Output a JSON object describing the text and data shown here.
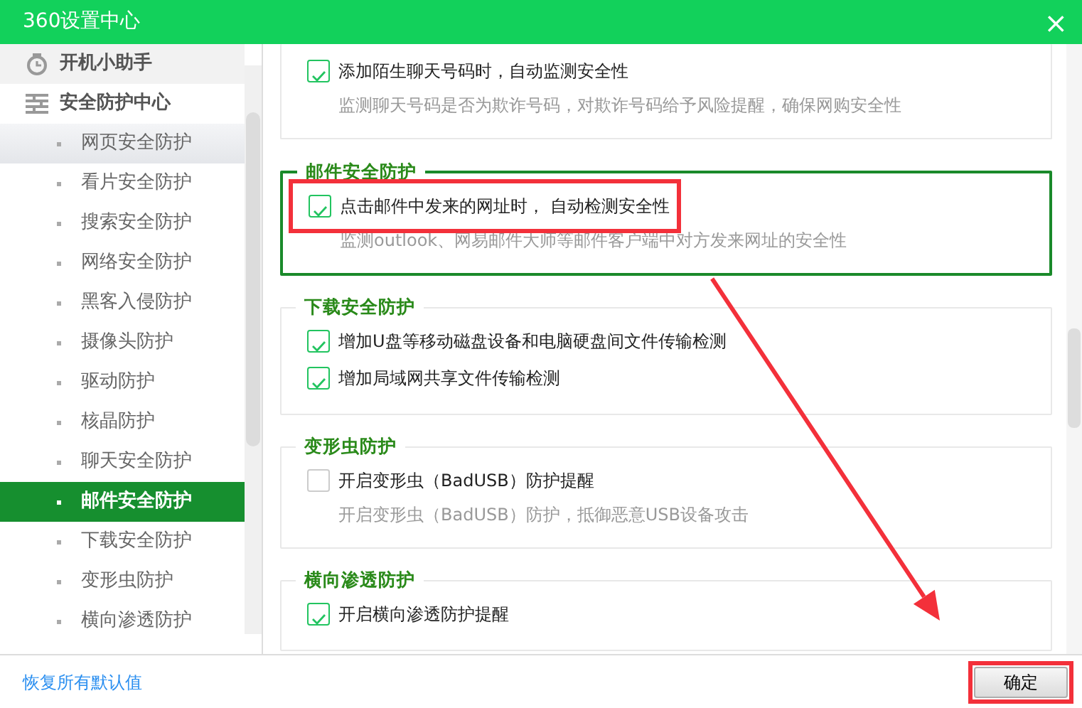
{
  "window": {
    "title": "360设置中心",
    "close": "×"
  },
  "sidebar": {
    "groups": [
      {
        "label": "开机小助手",
        "kind": "clock"
      },
      {
        "label": "安全防护中心",
        "kind": "wall",
        "children": [
          {
            "label": "网页安全防护",
            "selected": false,
            "hovered": true
          },
          {
            "label": "看片安全防护",
            "selected": false,
            "hovered": false
          },
          {
            "label": "搜索安全防护",
            "selected": false,
            "hovered": false
          },
          {
            "label": "网络安全防护",
            "selected": false,
            "hovered": false
          },
          {
            "label": "黑客入侵防护",
            "selected": false,
            "hovered": false
          },
          {
            "label": "摄像头防护",
            "selected": false,
            "hovered": false
          },
          {
            "label": "驱动防护",
            "selected": false,
            "hovered": false
          },
          {
            "label": "核晶防护",
            "selected": false,
            "hovered": false
          },
          {
            "label": "聊天安全防护",
            "selected": false,
            "hovered": false
          },
          {
            "label": "邮件安全防护",
            "selected": true,
            "hovered": false
          },
          {
            "label": "下载安全防护",
            "selected": false,
            "hovered": false
          },
          {
            "label": "变形虫防护",
            "selected": false,
            "hovered": false
          },
          {
            "label": "横向渗透防护",
            "selected": false,
            "hovered": false
          }
        ]
      }
    ]
  },
  "sections": [
    {
      "active": false,
      "items": [
        {
          "label": "添加陌生聊天号码时，自动监测安全性",
          "checked": true,
          "highlighted": false,
          "description": "监测聊天号码是否为欺诈号码，对欺诈号码给予风险提醒，确保网购安全性"
        }
      ]
    },
    {
      "title": "邮件安全防护",
      "active": true,
      "items": [
        {
          "label": "点击邮件中发来的网址时， 自动检测安全性",
          "checked": true,
          "highlighted": true,
          "description": "监测outlook、网易邮件大师等邮件客户端中对方发来网址的安全性"
        }
      ]
    },
    {
      "title": "下载安全防护",
      "active": false,
      "items": [
        {
          "label": "增加U盘等移动磁盘设备和电脑硬盘间文件传输检测",
          "checked": true,
          "highlighted": false
        },
        {
          "label": "增加局域网共享文件传输检测",
          "checked": true,
          "highlighted": false
        }
      ]
    },
    {
      "title": "变形虫防护",
      "active": false,
      "items": [
        {
          "label": "开启变形虫（BadUSB）防护提醒",
          "checked": false,
          "highlighted": false,
          "description": "开启变形虫（BadUSB）防护，抵御恶意USB设备攻击"
        }
      ]
    },
    {
      "title": "横向渗透防护",
      "active": false,
      "items": [
        {
          "label": "开启横向渗透防护提醒",
          "checked": true,
          "highlighted": false
        }
      ]
    }
  ],
  "footer": {
    "restore_link": "恢复所有默认值",
    "ok_button": {
      "label": "确定",
      "highlighted": true
    }
  }
}
